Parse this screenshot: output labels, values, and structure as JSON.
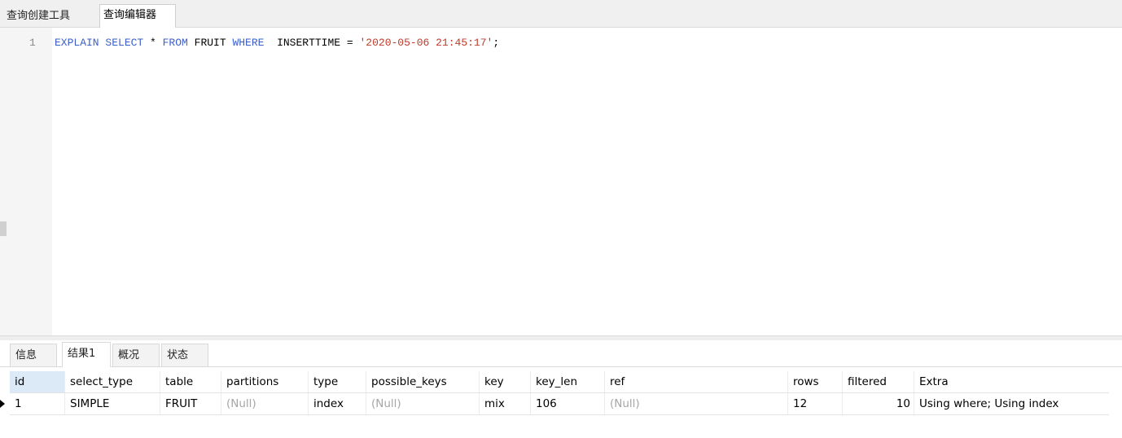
{
  "top_tabs": [
    {
      "label": "查询创建工具",
      "active": false
    },
    {
      "label": "查询编辑器",
      "active": true
    }
  ],
  "editor": {
    "line_number": "1",
    "tokens": [
      {
        "text": "EXPLAIN SELECT",
        "kind": "kw"
      },
      {
        "text": " * ",
        "kind": "plain"
      },
      {
        "text": "FROM",
        "kind": "kw"
      },
      {
        "text": " FRUIT ",
        "kind": "plain"
      },
      {
        "text": "WHERE",
        "kind": "kw"
      },
      {
        "text": "  INSERTTIME = ",
        "kind": "plain"
      },
      {
        "text": "'2020-05-06 21:45:17'",
        "kind": "str"
      },
      {
        "text": ";",
        "kind": "plain"
      }
    ]
  },
  "result_tabs": [
    {
      "label": "信息",
      "active": false
    },
    {
      "label": "结果1",
      "active": true
    },
    {
      "label": "概况",
      "active": false
    },
    {
      "label": "状态",
      "active": false
    }
  ],
  "grid": {
    "columns": [
      "id",
      "select_type",
      "table",
      "partitions",
      "type",
      "possible_keys",
      "key",
      "key_len",
      "ref",
      "rows",
      "filtered",
      "Extra"
    ],
    "rows": [
      [
        "1",
        "SIMPLE",
        "FRUIT",
        "(Null)",
        "index",
        "(Null)",
        "mix",
        "106",
        "(Null)",
        "12",
        "10",
        "Using where; Using index"
      ]
    ]
  },
  "colors": {
    "keyword": "#3a5fcd",
    "string": "#c0392b",
    "null_text": "#a6a6a6",
    "selected_header": "#dce9f7"
  }
}
